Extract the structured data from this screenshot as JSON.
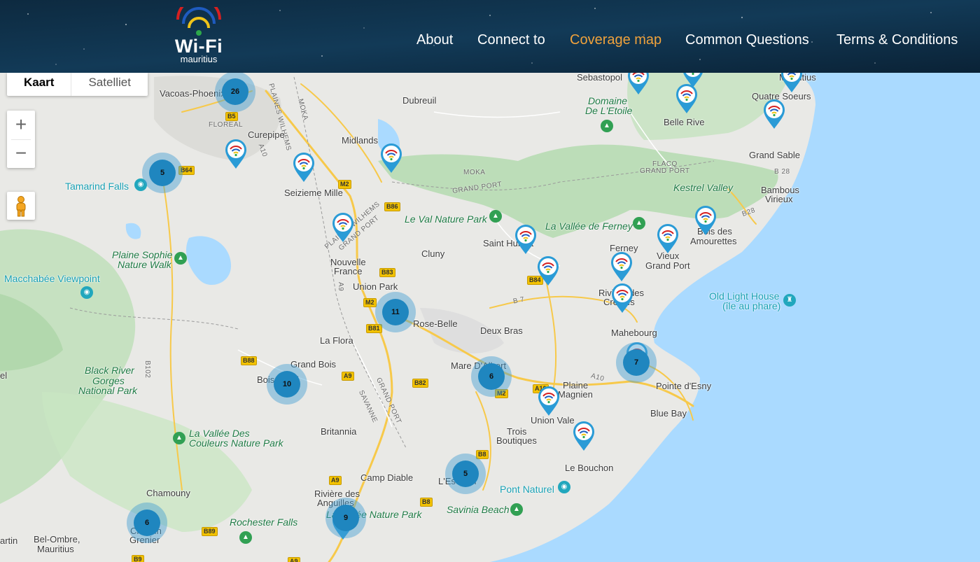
{
  "header": {
    "logo": {
      "title": "Wi-Fi",
      "subtitle": "mauritius"
    },
    "nav": [
      {
        "label": "About",
        "active": false
      },
      {
        "label": "Connect to",
        "active": false
      },
      {
        "label": "Coverage map",
        "active": true
      },
      {
        "label": "Common Questions",
        "active": false
      },
      {
        "label": "Terms & Conditions",
        "active": false
      }
    ],
    "colors": {
      "background": "#0a2337",
      "nav_text": "#ffffff",
      "nav_active": "#f0a23c"
    }
  },
  "map_controls": {
    "map_type": {
      "map": "Kaart",
      "satellite": "Satelliet",
      "selected": "Kaart"
    },
    "zoom_in": "+",
    "zoom_out": "−",
    "street_view": "pegman-icon"
  },
  "labels": {
    "vacoas": "Vacoas-Phoenix",
    "floreal": "FLOREAL",
    "curepipe": "Curepipe",
    "dubreuil": "Dubreuil",
    "midlands": "Midlands",
    "seizieme": "Seizieme Mille",
    "tamarind": "Tamarind Falls",
    "plaine_sophie": "Plaine Sophie",
    "nature_walk": "Nature Walk",
    "macchabee": "Macchabée Viewpoint",
    "black_river_1": "Black River",
    "black_river_2": "Gorges",
    "black_river_3": "National Park",
    "nouvelle_1": "Nouvelle",
    "nouvelle_2": "France",
    "union_park": "Union Park",
    "cluny": "Cluny",
    "rose_belle": "Rose-Belle",
    "la_flora": "La Flora",
    "grand_bois": "Grand Bois",
    "bois_cheri": "Bois Cheri",
    "deux_bras": "Deux Bras",
    "mare_albert": "Mare D'Albert",
    "saint_hubert": "Saint Hubert",
    "le_val": "Le Val Nature Park",
    "vallee_ferney": "La Vallée de Ferney",
    "ferney": "Ferney",
    "vieux_1": "Vieux",
    "vieux_2": "Grand Port",
    "riviere_creoles_1": "Rivière des",
    "riviere_creoles_2": "Créoles",
    "mahebourg": "Mahebourg",
    "old_lighthouse_1": "Old Light House",
    "old_lighthouse_2": "(île au phare)",
    "bois_amourettes_1": "Bois des",
    "bois_amourettes_2": "Amourettes",
    "kestrel": "Kestrel Valley",
    "bambous_1": "Bambous",
    "bambous_2": "Virieux",
    "grand_sable": "Grand Sable",
    "quatre_soeurs": "Quatre Soeurs",
    "belle_rive": "Belle Rive",
    "domaine_1": "Domaine",
    "domaine_2": "De L'Etoile",
    "sebastopol": "Sebastopol",
    "mahatma": "Mauritius",
    "pointe_esny": "Pointe d'Esny",
    "blue_bay": "Blue Bay",
    "plaine_magnien_1": "Plaine",
    "plaine_magnien_2": "Magnien",
    "union_vale": "Union Vale",
    "trois_1": "Trois",
    "trois_2": "Boutiques",
    "le_bouchon": "Le Bouchon",
    "pont_naturel": "Pont Naturel",
    "savinia": "Savinia Beach",
    "escalier": "L'Escalier",
    "camp_diable": "Camp Diable",
    "britannia": "Britannia",
    "riviere_anguilles_1": "Rivière des",
    "riviere_anguilles_2": "Anguilles",
    "vallee_nature": "La Vallée Nature Park",
    "rochester": "Rochester Falls",
    "chamouny": "Chamouny",
    "chemin_1": "Chemin",
    "chemin_2": "Grenier",
    "bel_ombre_1": "Bel-Ombre,",
    "bel_ombre_2": "Mauritius",
    "vallee_couleurs_1": "La Vallée Des",
    "vallee_couleurs_2": "Couleurs Nature Park",
    "artin": "artin",
    "el": "el",
    "moka_a": "MOKA",
    "moka_b": "MOKA",
    "grand_port_a": "GRAND PORT",
    "grand_port_b": "GRAND PORT",
    "flacq_1": "FLACQ",
    "flacq_2": "GRAND PORT",
    "plaines_wilhems": "PLAINES WILHEMS",
    "pw_gp_1": "PLAINES WILHEMS",
    "pw_gp_2": "GRAND PORT",
    "savanne": "SAVANNE",
    "gp_savanne": "GRAND PORT"
  },
  "roads": [
    "B5",
    "A10",
    "B64",
    "M2",
    "B86",
    "B83",
    "A9",
    "M2",
    "B81",
    "B88",
    "A9",
    "B82",
    "B84",
    "B 7",
    "A10",
    "A10",
    "M2",
    "B28",
    "B 28",
    "B8",
    "A9",
    "B8",
    "B89",
    "B9",
    "B102",
    "A9"
  ],
  "clusters": [
    {
      "count": "26"
    },
    {
      "count": "5"
    },
    {
      "count": "11"
    },
    {
      "count": "10"
    },
    {
      "count": "6"
    },
    {
      "count": "7"
    },
    {
      "count": "5"
    },
    {
      "count": "9"
    },
    {
      "count": "6"
    }
  ],
  "wifi_markers_count": 19,
  "colors": {
    "water": "#aadaff",
    "land": "#e9e9e6",
    "forest": "#b7dcb2",
    "road": "#f7c94a",
    "cluster": "#1f86bf",
    "pin": "#2a9bd6"
  }
}
